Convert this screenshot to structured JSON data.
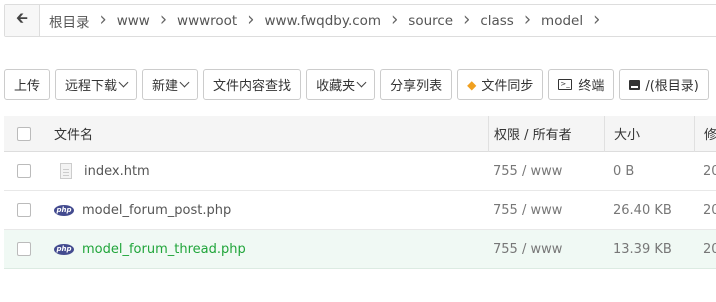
{
  "breadcrumb": {
    "items": [
      "根目录",
      "www",
      "wwwroot",
      "www.fwqdby.com",
      "source",
      "class",
      "model"
    ]
  },
  "toolbar": {
    "upload": "上传",
    "remote_download": "远程下载",
    "new": "新建",
    "content_search": "文件内容查找",
    "favorites": "收藏夹",
    "share_list": "分享列表",
    "file_sync": "文件同步",
    "terminal": "终端",
    "root_dir": "/(根目录)"
  },
  "table": {
    "headers": {
      "name": "文件名",
      "permission": "权限 / 所有者",
      "size": "大小",
      "modified": "修"
    },
    "rows": [
      {
        "name": "index.htm",
        "icon": "html-file-icon",
        "perm": "755 / www",
        "size": "0 B",
        "mod": "20"
      },
      {
        "name": "model_forum_post.php",
        "icon": "php-icon",
        "perm": "755 / www",
        "size": "26.40 KB",
        "mod": "20"
      },
      {
        "name": "model_forum_thread.php",
        "icon": "php-icon",
        "perm": "755 / www",
        "size": "13.39 KB",
        "mod": "20"
      }
    ]
  },
  "colors": {
    "accent_green": "#20a53a",
    "php_badge": "#434b8f",
    "sync_gem": "#f0a020"
  }
}
